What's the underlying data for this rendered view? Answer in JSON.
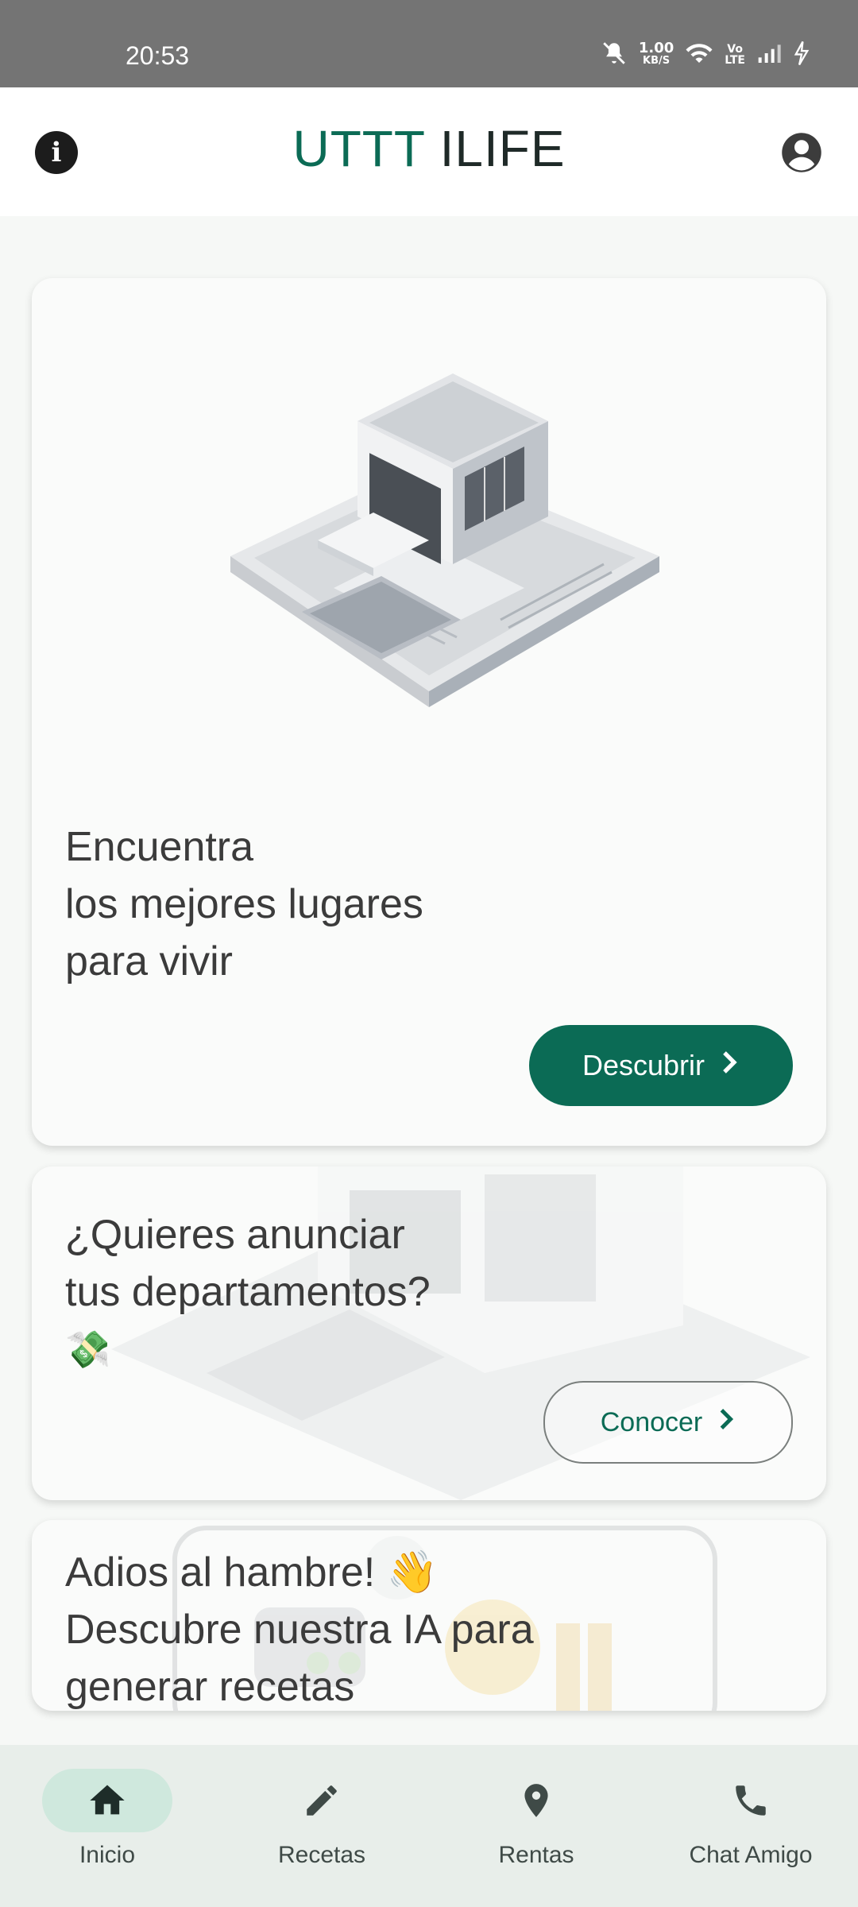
{
  "status_bar": {
    "time": "20:53",
    "net_speed": "1.00",
    "net_unit": "KB/S",
    "icons": [
      "mute-icon",
      "wifi-icon",
      "volte-icon",
      "signal-icon",
      "charging-icon"
    ]
  },
  "app_bar": {
    "title_part1": "UTTT",
    "title_part2": "ILIFE",
    "left_icon": "info-icon",
    "right_icon": "account-icon"
  },
  "cards": [
    {
      "lines": [
        "Encuentra",
        "los mejores lugares",
        "para vivir"
      ],
      "button": "Descubrir"
    },
    {
      "lines": [
        "¿Quieres anunciar",
        "tus departamentos?",
        "💸"
      ],
      "button": "Conocer"
    },
    {
      "lines": [
        "Adios al hambre! 👋",
        "Descubre nuestra IA para",
        "generar recetas"
      ]
    }
  ],
  "bottom_nav": [
    {
      "label": "Inicio",
      "icon": "home-icon",
      "active": true
    },
    {
      "label": "Recetas",
      "icon": "pencil-icon",
      "active": false
    },
    {
      "label": "Rentas",
      "icon": "location-pin-icon",
      "active": false
    },
    {
      "label": "Chat Amigo",
      "icon": "phone-icon",
      "active": false
    }
  ],
  "colors": {
    "accent": "#0b6b55",
    "nav_background": "#e8eeea",
    "nav_active_pill": "#cfe8dd"
  }
}
